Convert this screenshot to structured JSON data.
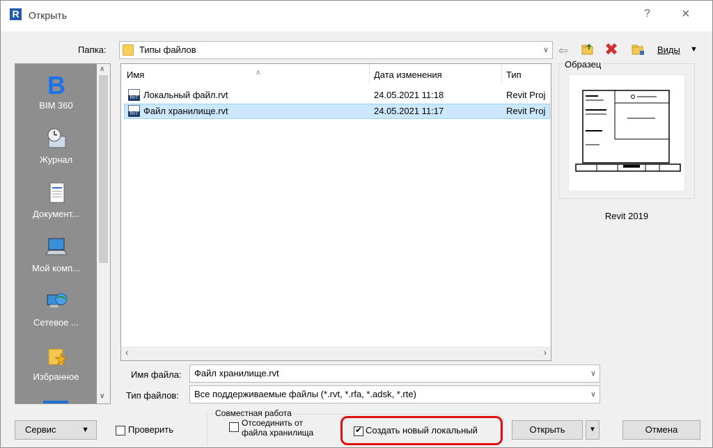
{
  "window": {
    "app_icon": "R",
    "title": "Открыть",
    "help_label": "?",
    "close_label": "×"
  },
  "folder": {
    "label": "Папка:",
    "value": "Типы файлов",
    "views_label": "Виды"
  },
  "places": {
    "items": [
      {
        "label": "BIM 360",
        "icon": "bim360-icon"
      },
      {
        "label": "Журнал",
        "icon": "history-icon"
      },
      {
        "label": "Документ...",
        "icon": "documents-icon"
      },
      {
        "label": "Мой комп...",
        "icon": "computer-icon"
      },
      {
        "label": "Сетевое ...",
        "icon": "network-icon"
      },
      {
        "label": "Избранное",
        "icon": "favorites-icon"
      }
    ]
  },
  "filelist": {
    "columns": [
      "Имя",
      "Дата изменения",
      "Тип"
    ],
    "rows": [
      {
        "name": "Локальный файл.rvt",
        "date": "24.05.2021 11:18",
        "type": "Revit Proj",
        "selected": false
      },
      {
        "name": "Файл хранилище.rvt",
        "date": "24.05.2021 11:17",
        "type": "Revit Proj",
        "selected": true
      }
    ]
  },
  "preview": {
    "label": "Образец",
    "caption": "Revit 2019"
  },
  "fields": {
    "filename_label": "Имя файла:",
    "filename_value": "Файл хранилище.rvt",
    "filetype_label": "Тип файлов:",
    "filetype_value": "Все поддерживаемые файлы  (*.rvt, *.rfa, *.adsk, *.rte)"
  },
  "bottom": {
    "service_label": "Сервис",
    "verify_label": "Проверить",
    "collab_title": "Совместная работа",
    "detach_label": "Отсоединить от файла хранилища",
    "create_local_label": "Создать новый локальный",
    "create_local_checked": true,
    "open_label": "Открыть",
    "cancel_label": "Отмена"
  },
  "colors": {
    "selection": "#cce8ff",
    "highlight": "#e01010",
    "places_bg": "#8e8e8e"
  }
}
